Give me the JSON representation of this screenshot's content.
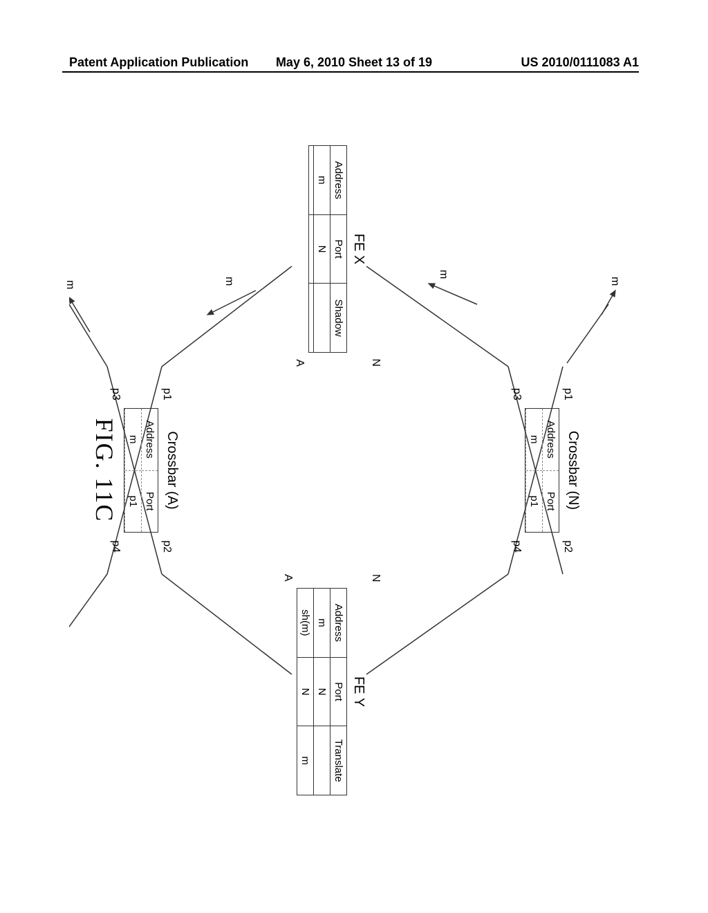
{
  "header": {
    "left": "Patent Application Publication",
    "center": "May 6, 2010  Sheet 13 of 19",
    "right": "US 2010/0111083 A1"
  },
  "diagram": {
    "crossbar_n": {
      "label": "Crossbar (N)",
      "headers": [
        "Address",
        "Port"
      ],
      "row": [
        "m",
        "p1"
      ],
      "ports": {
        "p1": "p1",
        "p2": "p2",
        "p3": "p3",
        "p4": "p4"
      }
    },
    "crossbar_a": {
      "label": "Crossbar (A)",
      "headers": [
        "Address",
        "Port"
      ],
      "row": [
        "m",
        "p1"
      ],
      "ports": {
        "p1": "p1",
        "p2": "p2",
        "p3": "p3",
        "p4": "p4"
      }
    },
    "fe_x": {
      "label": "FE X",
      "headers": [
        "Address",
        "Port",
        "Shadow"
      ],
      "rows": [
        [
          "m",
          "N",
          ""
        ],
        [
          "",
          "",
          ""
        ]
      ],
      "ports": {
        "n": "N",
        "a": "A"
      }
    },
    "fe_y": {
      "label": "FE Y",
      "headers": [
        "Address",
        "Port",
        "Translate"
      ],
      "rows": [
        [
          "m",
          "N",
          ""
        ],
        [
          "sh(m)",
          "N",
          "m"
        ]
      ],
      "ports": {
        "n": "N",
        "a": "A"
      }
    },
    "flows": {
      "m1": "m",
      "m2": "m",
      "m3": "m",
      "m4": "m"
    },
    "figure_label": "FIG. 11C"
  }
}
